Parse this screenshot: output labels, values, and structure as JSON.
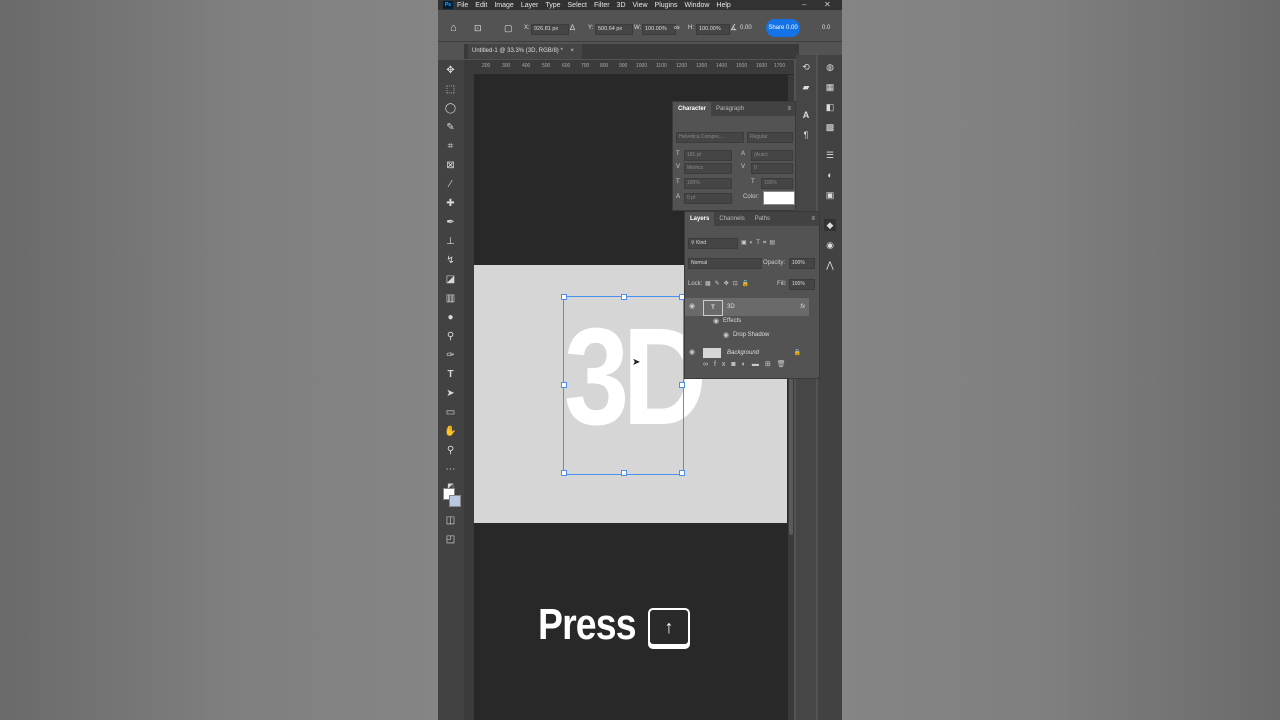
{
  "app": {
    "logo": "Ps",
    "menu": [
      "File",
      "Edit",
      "Image",
      "Layer",
      "Type",
      "Select",
      "Filter",
      "3D",
      "View",
      "Plugins",
      "Window",
      "Help"
    ]
  },
  "options": {
    "x_label": "X:",
    "x_value": "926.81 px",
    "y_label": "Y:",
    "y_value": "500.64 px",
    "w_label": "W:",
    "w_value": "100.00%",
    "h_label": "H:",
    "h_value": "100.00%",
    "angle_value": "0.00",
    "share_label": "Share",
    "share_suffix": "0.00",
    "right_value": "0.0"
  },
  "document_tab": {
    "title": "Untitled-1 @ 33.3% (3D, RGB/8) *",
    "close": "×"
  },
  "ruler_labels": [
    "200",
    "300",
    "400",
    "500",
    "600",
    "700",
    "800",
    "900",
    "1000",
    "1100",
    "1200",
    "1300",
    "1400",
    "1500",
    "1600",
    "1700"
  ],
  "canvas": {
    "text_layer": "3D",
    "overlay_caption": "Press",
    "key_glyph": "↑"
  },
  "character_panel": {
    "tabs": [
      "Character",
      "Paragraph"
    ],
    "font_family": "Helvetica Compre...",
    "font_style": "Regular",
    "size": "181 pt",
    "leading": "(Auto)",
    "kerning": "Metrics",
    "tracking": "0",
    "vscale": "100%",
    "hscale": "100%",
    "baseline": "0 pt",
    "color_label": "Color:",
    "color_swatch": "#ffffff"
  },
  "layers_panel": {
    "tabs": [
      "Layers",
      "Channels",
      "Paths"
    ],
    "filter_kind": "Kind",
    "blend_mode": "Normal",
    "opacity_label": "Opacity:",
    "opacity": "100%",
    "lock_label": "Lock:",
    "fill_label": "Fill:",
    "fill": "100%",
    "layers": [
      {
        "name": "3D",
        "fx": "fx"
      },
      {
        "name": "Effects"
      },
      {
        "name": "Drop Shadow"
      },
      {
        "name": "Background"
      }
    ]
  }
}
